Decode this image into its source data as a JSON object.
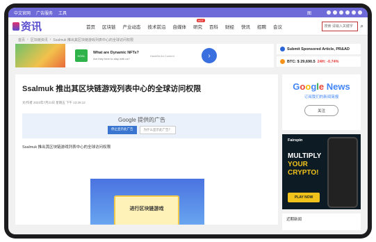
{
  "topbar": {
    "items": [
      "中文官网",
      "广告服务",
      "工具"
    ],
    "mid": "图"
  },
  "nav": {
    "logo_text": "资讯",
    "menu": [
      "首页",
      "区块链",
      "产业动态",
      "技术前沿",
      "自媒体",
      "研究",
      "百科",
      "财经",
      "快讯",
      "招聘",
      "会议"
    ],
    "hot_badge": "HOT",
    "search_placeholder": "搜索 请输入关键字"
  },
  "breadcrumb": [
    "首页",
    "区块链资讯",
    "Ssalmuk 推出其区块链游戏列表中心的全球访问权限"
  ],
  "ad": {
    "question": "What are Dynamic NFTs?",
    "question_sub": "Are they here to stay with us?",
    "hodl": "HODL",
    "right_sub": "HashBit Ad Content",
    "arrow": "›"
  },
  "promos": [
    {
      "text": "Submit Sponsored Article, PR&AD"
    },
    {
      "text": "BTC: $ 29,690.5",
      "change": "24H: -0.74%"
    }
  ],
  "article": {
    "title": "Ssalmuk 推出其区块链游戏列表中心的全球访问权限",
    "meta": "文/作者  2023年7月21日 星期五 下午 13:26:12",
    "google_ad_title": "Google 提供的广告",
    "btn_stop": "停止显示此广告",
    "btn_why": "为什么显示此广告？",
    "lead": "Ssalmuk 推出其区块链游戏列表中心的全球访问权限",
    "screenshot_text": "进行区块链游戏"
  },
  "sidebar": {
    "gnews_title": [
      "G",
      "o",
      "o",
      "g",
      "l",
      "e",
      " News"
    ],
    "gnews_sub": "订阅我们的新闻简报",
    "gnews_btn": "关注",
    "fairspin_brand": "Fairspin",
    "fairspin_lines": [
      "MULTIPLY",
      "YOUR",
      "CRYPTO!"
    ],
    "fairspin_btn": "PLAY NOW",
    "recent": "近期新闻"
  }
}
